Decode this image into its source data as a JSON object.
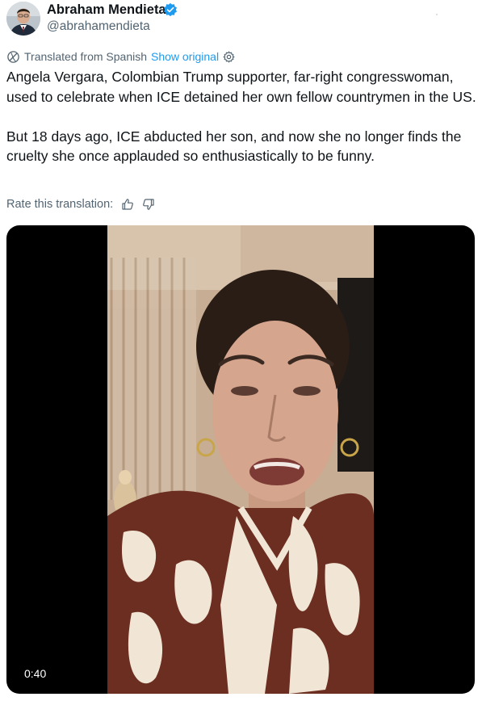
{
  "author": {
    "display_name": "Abraham Mendieta",
    "handle": "@abrahamendieta",
    "verified": true,
    "verified_color": "#1d9bf0"
  },
  "translation": {
    "label": "Translated from Spanish",
    "show_original": "Show original",
    "link_color": "#1d9bf0"
  },
  "tweet": {
    "paragraphs": [
      "Angela Vergara, Colombian Trump supporter, far-right congresswoman, used to celebrate when ICE detained her own fellow countrymen in the US.",
      "But 18 days ago, ICE abducted her son, and now she no longer finds the cruelty she once applauded so enthusiastically to be funny."
    ]
  },
  "rate": {
    "label": "Rate this translation:",
    "icons": [
      "thumbs-up-icon",
      "thumbs-down-icon"
    ]
  },
  "video": {
    "duration": "0:40",
    "background": "#000000"
  }
}
